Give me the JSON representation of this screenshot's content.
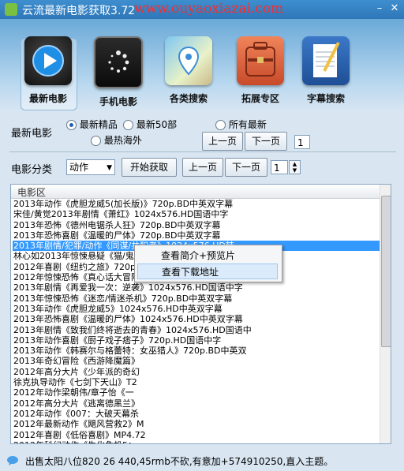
{
  "window": {
    "title": "云流最新电影获取3.72",
    "watermark": "www.ouyaoxiazai.com"
  },
  "toolbar": [
    {
      "label": "最新电影",
      "icon": "play-icon",
      "selected": true
    },
    {
      "label": "手机电影",
      "icon": "video-loading-icon"
    },
    {
      "label": "各类搜索",
      "icon": "map-pin-icon"
    },
    {
      "label": "拓展专区",
      "icon": "suitcase-icon"
    },
    {
      "label": "字幕搜索",
      "icon": "notepad-pen-icon"
    }
  ],
  "latest": {
    "label": "最新电影",
    "options": [
      "最新精品",
      "最新50部",
      "所有最新",
      "最热海外"
    ],
    "selected": "最新精品",
    "prev": "上一页",
    "next": "下一页",
    "page": "1"
  },
  "category": {
    "label": "电影分类",
    "select_value": "动作",
    "fetch": "开始获取",
    "prev": "上一页",
    "next": "下一页",
    "page": "1"
  },
  "list": {
    "header": "电影区",
    "rows": [
      "2013年动作《虎胆龙威5(加长版)》720p.BD中英双字幕",
      "宋佳/黄觉2013年剧情《萧红》1024x576.HD国语中字",
      "2013年恐怖《德州电锯杀人狂》720p.BD中英双字幕",
      "2013年恐怖喜剧《温暖的尸体》720p.BD中英双字幕",
      "2013年剧情/犯罪/动作《同谋/共犯者》1024x576.HD韩",
      "林心如2013年惊悚悬疑《猫/鬼猫》",
      "2012年喜剧《纽约之旅》720p",
      "2012年惊悚恐怖《真心话大冒险》",
      "2013年剧情《再爱我一次：逆袭》1024x576.HD国语中字",
      "2013年惊悚恐怖《迷恋/情迷杀机》720p.BD中英双字幕",
      "2013年动作《虎胆龙威5》1024x576.HD中英双字幕",
      "2013年恐怖喜剧《温暖的尸体》1024x576.HD中英双字幕",
      "2013年剧情《致我们终将逝去的青春》1024x576.HD国语中",
      "2013年动作喜剧《厨子戏子痞子》720p.HD国语中字",
      "2013年动作《韩赛尔与格蕾特：女巫猎人》720p.BD中英双",
      "2013年奇幻冒险《西游降魔篇》",
      "2012年高分大片《少年派的奇幻",
      "徐克执导动作《七剑下天山》T2",
      "2012年动作梁朝伟/章子怡《一",
      "2012年高分大片《逃离德黑兰》",
      "2012年动作《007：大破天幕杀",
      "2012年最新动作《飓风营救2》M",
      "2012年喜剧《低俗喜剧》MP4.72",
      "2012年科幻动作《生化危机5："
    ],
    "selected_index": 4
  },
  "context_menu": [
    "查看简介+预览片",
    "查看下载地址"
  ],
  "status": {
    "text": "出售太阳八位820 26 440,45rmb不砍,有意加+574910250,直入主题。"
  },
  "colors": {
    "selection": "#3399ff",
    "title_bar": "#3e8fcf",
    "watermark": "#ff2a2a"
  }
}
